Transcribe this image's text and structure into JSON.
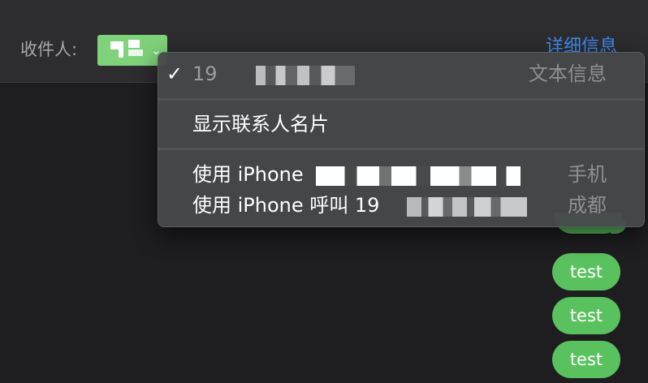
{
  "header": {
    "to_label": "收件人:",
    "details_link": "详细信息"
  },
  "recipient": {
    "chevron": "⌄"
  },
  "menu": {
    "selected_number": {
      "checkmark": "✓",
      "prefix": "19",
      "right_label": "文本信息"
    },
    "show_contact_card": {
      "label": "显示联系人名片"
    },
    "call_with_iphone": {
      "label": "使用 iPhone",
      "right_label": "手机"
    },
    "call_with_iphone_number": {
      "label": "使用 iPhone 呼叫 19",
      "right_label": "成都"
    }
  },
  "messages": [
    {
      "text": "test"
    },
    {
      "text": "test"
    },
    {
      "text": "test"
    }
  ],
  "colors": {
    "header_bg": "#2d2d2f",
    "chat_bg": "#1e1e21",
    "bubble": "#5ac15f",
    "token": "#7ed27a",
    "link": "#3d8cf0",
    "menu_bg": "#464849"
  }
}
